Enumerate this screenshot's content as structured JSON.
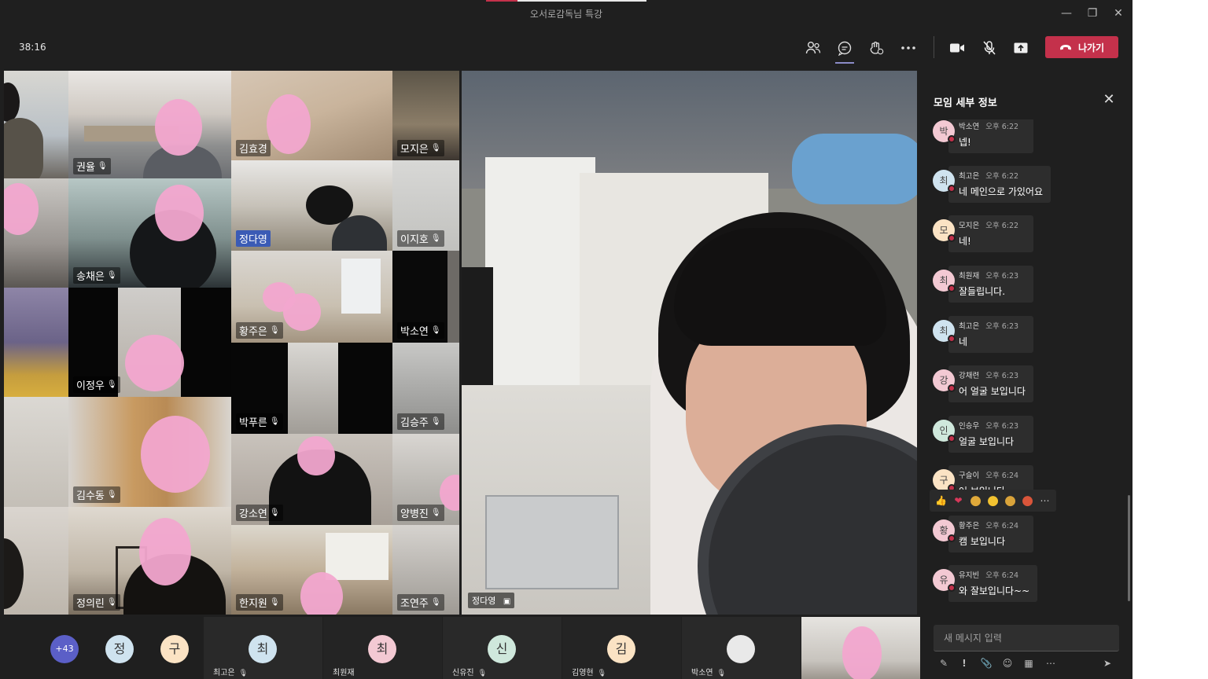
{
  "window": {
    "title": "오서로감독님 특강",
    "minimize_icon": "minimize-icon",
    "restore_icon": "restore-icon",
    "close_icon": "close-icon"
  },
  "toolbar": {
    "timer": "38:16",
    "buttons": [
      "participants-icon",
      "chat-icon",
      "reactions-icon",
      "more-icon",
      "camera-icon",
      "mic-off-icon",
      "share-icon"
    ],
    "leave_label": "나가기",
    "leave_color": "#c4314b"
  },
  "grid_tiles": [
    {
      "name": "권율"
    },
    {
      "name": "김효경"
    },
    {
      "name": "모지은"
    },
    {
      "name": "정다영"
    },
    {
      "name": "이지호"
    },
    {
      "name": "송채은"
    },
    {
      "name": "황주은"
    },
    {
      "name": "박소연"
    },
    {
      "name": "이정우"
    },
    {
      "name": "박푸른"
    },
    {
      "name": "김승주"
    },
    {
      "name": "김수동"
    },
    {
      "name": "강소연"
    },
    {
      "name": "양병진"
    },
    {
      "name": "정의린"
    },
    {
      "name": "한지원"
    },
    {
      "name": "조연주"
    }
  ],
  "main_video": {
    "name": "정다영"
  },
  "panel": {
    "title": "모임 세부 정보",
    "messages": [
      {
        "initial": "박",
        "sender": "박소연",
        "time": "오후 6:22",
        "text": "넵!",
        "avatar_color": "#f3c9d3"
      },
      {
        "initial": "최",
        "sender": "최고은",
        "time": "오후 6:22",
        "text": "네 메인으로 가있어요",
        "avatar_color": "#cfe3ef"
      },
      {
        "initial": "모",
        "sender": "모지은",
        "time": "오후 6:22",
        "text": "네!",
        "avatar_color": "#fbe3c4"
      },
      {
        "initial": "최",
        "sender": "최원재",
        "time": "오후 6:23",
        "text": "잘들립니다.",
        "avatar_color": "#f3c9d3"
      },
      {
        "initial": "최",
        "sender": "최고은",
        "time": "오후 6:23",
        "text": "네",
        "avatar_color": "#cfe3ef"
      },
      {
        "initial": "강",
        "sender": "강채련",
        "time": "오후 6:23",
        "text": "어 얼굴 보입니다",
        "avatar_color": "#f3c9d3"
      },
      {
        "initial": "인",
        "sender": "인승우",
        "time": "오후 6:23",
        "text": "얼굴 보입니다",
        "avatar_color": "#cfe8dc"
      },
      {
        "initial": "구",
        "sender": "구슬이",
        "time": "오후 6:24",
        "text": "어 보입니다",
        "avatar_color": "#fbe3c4"
      },
      {
        "initial": "황",
        "sender": "황주은",
        "time": "오후 6:24",
        "text": "캠 보입니다",
        "avatar_color": "#f3c9d3"
      },
      {
        "initial": "유",
        "sender": "유지빈",
        "time": "오후 6:24",
        "text": "와 잘보입니다~~",
        "avatar_color": "#f3c9d3"
      }
    ],
    "reactions": [
      "like-icon",
      "heart-icon",
      "laugh-icon",
      "surprised-icon",
      "sad-icon",
      "angry-icon",
      "more-icon"
    ],
    "compose_placeholder": "새 메시지 입력",
    "compose_tools": [
      "format-icon",
      "important-icon",
      "attach-icon",
      "emoji-icon",
      "sticker-icon",
      "more-options-icon",
      "send-icon"
    ]
  },
  "strip": {
    "overflow_count": "+43",
    "people": [
      {
        "initial": "정",
        "name": "",
        "color": "#cfe3ef"
      },
      {
        "initial": "구",
        "name": "",
        "color": "#fbe3c4"
      },
      {
        "initial": "최",
        "name": "최고은",
        "color": "#cfe3ef"
      },
      {
        "initial": "최",
        "name": "최원재",
        "color": "#f3c9d3"
      },
      {
        "initial": "신",
        "name": "신유진",
        "color": "#cfe8dc"
      },
      {
        "initial": "김",
        "name": "김영현",
        "color": "#fbe3c4"
      },
      {
        "initial": "",
        "name": "박소연",
        "color": "#e9e9e9"
      }
    ]
  }
}
